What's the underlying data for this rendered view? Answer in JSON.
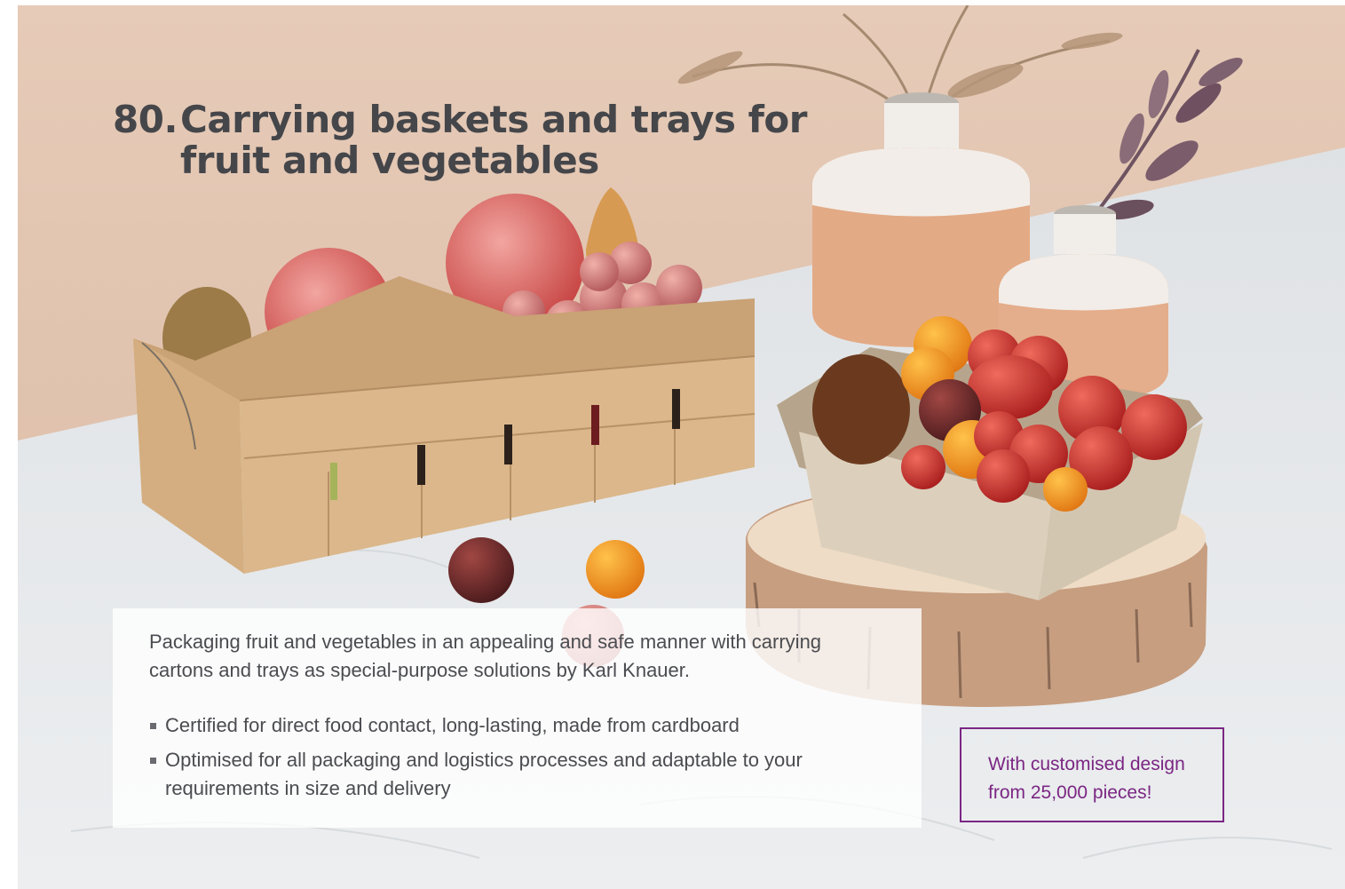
{
  "heading": {
    "number": "80.",
    "line1": "Carrying baskets and trays for",
    "line2": "fruit and vegetables"
  },
  "body": {
    "intro": "Packaging fruit and vegetables in an appealing and safe manner with carrying cartons and trays as special-purpose solutions by Karl Knauer.",
    "bullets": [
      "Certified for direct food contact, long-lasting, made from cardboard",
      "Optimised for all packaging and logistics processes and adaptable to your requirements in size and delivery"
    ]
  },
  "promo": {
    "text": "With customised design from 25,000 pieces!"
  },
  "colors": {
    "heading": "#45464a",
    "body_text": "#4b4c50",
    "accent_purple": "#7b2683",
    "wall": "#e2c3ad",
    "marble": "#e6e8ea",
    "cardboard": "#d9b489"
  }
}
